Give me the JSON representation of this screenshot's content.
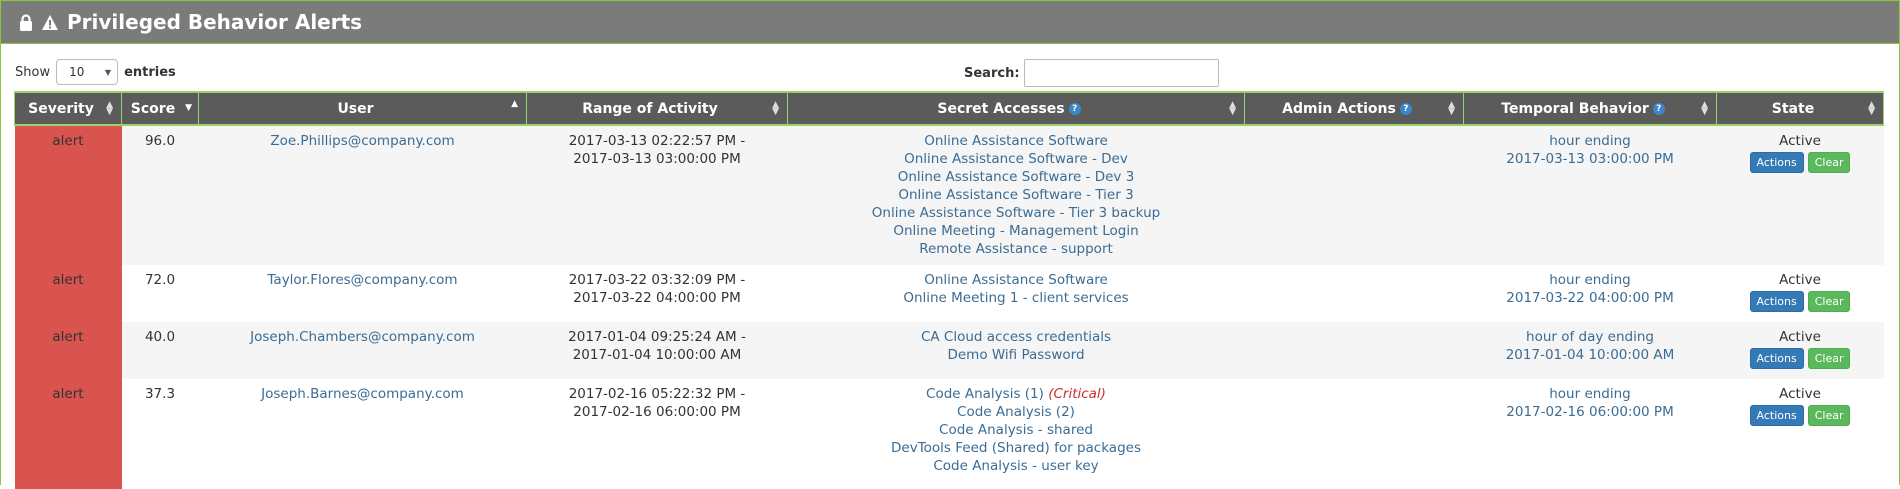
{
  "panel": {
    "title": "Privileged Behavior Alerts",
    "lock_icon": "lock-icon",
    "warning_icon": "warning-icon"
  },
  "controls": {
    "show_label": "Show",
    "entries_value": "10",
    "entries_label": "entries",
    "search_label": "Search:",
    "search_value": ""
  },
  "columns": {
    "severity": "Severity",
    "score": "Score",
    "user": "User",
    "range": "Range of Activity",
    "secret": "Secret Accesses",
    "admin": "Admin Actions",
    "temporal": "Temporal Behavior",
    "state": "State"
  },
  "colors": {
    "header_bg": "#7b7b7b",
    "table_header_bg": "#5b5b5b",
    "severity_alert": "#d9534f",
    "link": "#3b6c94",
    "actions_button": "#337ab7",
    "clear_button": "#5cb85c",
    "border_accent": "#8cc63f"
  },
  "rows": [
    {
      "severity": "alert",
      "score": "96.0",
      "user": "Zoe.Phillips@company.com",
      "range_start": "2017-03-13 02:22:57 PM -",
      "range_end": "2017-03-13 03:00:00 PM",
      "secrets": [
        "Online Assistance Software",
        "Online Assistance Software - Dev",
        "Online Assistance Software - Dev 3",
        "Online Assistance Software - Tier 3",
        "Online Assistance Software - Tier 3 backup",
        "Online Meeting - Management Login",
        "Remote Assistance - support"
      ],
      "admin": "",
      "temporal_label": "hour ending",
      "temporal_value": "2017-03-13 03:00:00 PM",
      "state": "Active",
      "actions_label": "Actions",
      "clear_label": "Clear"
    },
    {
      "severity": "alert",
      "score": "72.0",
      "user": "Taylor.Flores@company.com",
      "range_start": "2017-03-22 03:32:09 PM -",
      "range_end": "2017-03-22 04:00:00 PM",
      "secrets": [
        "Online Assistance Software",
        "Online Meeting 1 - client services"
      ],
      "admin": "",
      "temporal_label": "hour ending",
      "temporal_value": "2017-03-22 04:00:00 PM",
      "state": "Active",
      "actions_label": "Actions",
      "clear_label": "Clear"
    },
    {
      "severity": "alert",
      "score": "40.0",
      "user": "Joseph.Chambers@company.com",
      "range_start": "2017-01-04 09:25:24 AM -",
      "range_end": "2017-01-04 10:00:00 AM",
      "secrets": [
        "CA Cloud access credentials",
        "Demo Wifi Password"
      ],
      "admin": "",
      "temporal_label": "hour of day ending",
      "temporal_value": "2017-01-04 10:00:00 AM",
      "state": "Active",
      "actions_label": "Actions",
      "clear_label": "Clear"
    },
    {
      "severity": "alert",
      "score": "37.3",
      "user": "Joseph.Barnes@company.com",
      "range_start": "2017-02-16 05:22:32 PM -",
      "range_end": "2017-02-16 06:00:00 PM",
      "secrets": [
        "Code Analysis (1)",
        "Code Analysis (2)",
        "Code Analysis - shared",
        "DevTools Feed (Shared) for packages",
        "Code Analysis - user key"
      ],
      "secret_critical_label": "(Critical)",
      "admin": "",
      "temporal_label": "hour ending",
      "temporal_value": "2017-02-16 06:00:00 PM",
      "state": "Active",
      "actions_label": "Actions",
      "clear_label": "Clear"
    }
  ]
}
